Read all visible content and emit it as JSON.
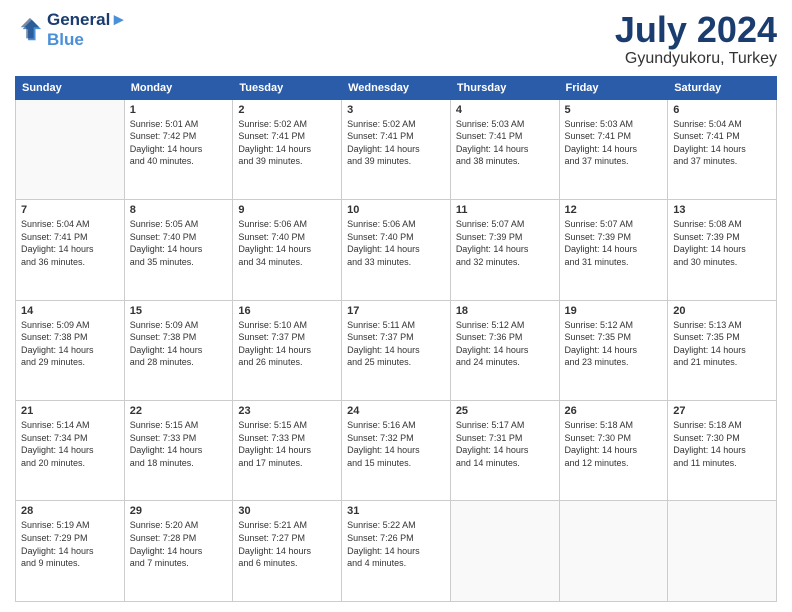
{
  "header": {
    "logo_line1": "General",
    "logo_line2": "Blue",
    "main_title": "July 2024",
    "subtitle": "Gyundyukoru, Turkey"
  },
  "weekdays": [
    "Sunday",
    "Monday",
    "Tuesday",
    "Wednesday",
    "Thursday",
    "Friday",
    "Saturday"
  ],
  "weeks": [
    [
      {
        "day": "",
        "sunrise": "",
        "sunset": "",
        "daylight": ""
      },
      {
        "day": "1",
        "sunrise": "Sunrise: 5:01 AM",
        "sunset": "Sunset: 7:42 PM",
        "daylight": "Daylight: 14 hours and 40 minutes."
      },
      {
        "day": "2",
        "sunrise": "Sunrise: 5:02 AM",
        "sunset": "Sunset: 7:41 PM",
        "daylight": "Daylight: 14 hours and 39 minutes."
      },
      {
        "day": "3",
        "sunrise": "Sunrise: 5:02 AM",
        "sunset": "Sunset: 7:41 PM",
        "daylight": "Daylight: 14 hours and 39 minutes."
      },
      {
        "day": "4",
        "sunrise": "Sunrise: 5:03 AM",
        "sunset": "Sunset: 7:41 PM",
        "daylight": "Daylight: 14 hours and 38 minutes."
      },
      {
        "day": "5",
        "sunrise": "Sunrise: 5:03 AM",
        "sunset": "Sunset: 7:41 PM",
        "daylight": "Daylight: 14 hours and 37 minutes."
      },
      {
        "day": "6",
        "sunrise": "Sunrise: 5:04 AM",
        "sunset": "Sunset: 7:41 PM",
        "daylight": "Daylight: 14 hours and 37 minutes."
      }
    ],
    [
      {
        "day": "7",
        "sunrise": "Sunrise: 5:04 AM",
        "sunset": "Sunset: 7:41 PM",
        "daylight": "Daylight: 14 hours and 36 minutes."
      },
      {
        "day": "8",
        "sunrise": "Sunrise: 5:05 AM",
        "sunset": "Sunset: 7:40 PM",
        "daylight": "Daylight: 14 hours and 35 minutes."
      },
      {
        "day": "9",
        "sunrise": "Sunrise: 5:06 AM",
        "sunset": "Sunset: 7:40 PM",
        "daylight": "Daylight: 14 hours and 34 minutes."
      },
      {
        "day": "10",
        "sunrise": "Sunrise: 5:06 AM",
        "sunset": "Sunset: 7:40 PM",
        "daylight": "Daylight: 14 hours and 33 minutes."
      },
      {
        "day": "11",
        "sunrise": "Sunrise: 5:07 AM",
        "sunset": "Sunset: 7:39 PM",
        "daylight": "Daylight: 14 hours and 32 minutes."
      },
      {
        "day": "12",
        "sunrise": "Sunrise: 5:07 AM",
        "sunset": "Sunset: 7:39 PM",
        "daylight": "Daylight: 14 hours and 31 minutes."
      },
      {
        "day": "13",
        "sunrise": "Sunrise: 5:08 AM",
        "sunset": "Sunset: 7:39 PM",
        "daylight": "Daylight: 14 hours and 30 minutes."
      }
    ],
    [
      {
        "day": "14",
        "sunrise": "Sunrise: 5:09 AM",
        "sunset": "Sunset: 7:38 PM",
        "daylight": "Daylight: 14 hours and 29 minutes."
      },
      {
        "day": "15",
        "sunrise": "Sunrise: 5:09 AM",
        "sunset": "Sunset: 7:38 PM",
        "daylight": "Daylight: 14 hours and 28 minutes."
      },
      {
        "day": "16",
        "sunrise": "Sunrise: 5:10 AM",
        "sunset": "Sunset: 7:37 PM",
        "daylight": "Daylight: 14 hours and 26 minutes."
      },
      {
        "day": "17",
        "sunrise": "Sunrise: 5:11 AM",
        "sunset": "Sunset: 7:37 PM",
        "daylight": "Daylight: 14 hours and 25 minutes."
      },
      {
        "day": "18",
        "sunrise": "Sunrise: 5:12 AM",
        "sunset": "Sunset: 7:36 PM",
        "daylight": "Daylight: 14 hours and 24 minutes."
      },
      {
        "day": "19",
        "sunrise": "Sunrise: 5:12 AM",
        "sunset": "Sunset: 7:35 PM",
        "daylight": "Daylight: 14 hours and 23 minutes."
      },
      {
        "day": "20",
        "sunrise": "Sunrise: 5:13 AM",
        "sunset": "Sunset: 7:35 PM",
        "daylight": "Daylight: 14 hours and 21 minutes."
      }
    ],
    [
      {
        "day": "21",
        "sunrise": "Sunrise: 5:14 AM",
        "sunset": "Sunset: 7:34 PM",
        "daylight": "Daylight: 14 hours and 20 minutes."
      },
      {
        "day": "22",
        "sunrise": "Sunrise: 5:15 AM",
        "sunset": "Sunset: 7:33 PM",
        "daylight": "Daylight: 14 hours and 18 minutes."
      },
      {
        "day": "23",
        "sunrise": "Sunrise: 5:15 AM",
        "sunset": "Sunset: 7:33 PM",
        "daylight": "Daylight: 14 hours and 17 minutes."
      },
      {
        "day": "24",
        "sunrise": "Sunrise: 5:16 AM",
        "sunset": "Sunset: 7:32 PM",
        "daylight": "Daylight: 14 hours and 15 minutes."
      },
      {
        "day": "25",
        "sunrise": "Sunrise: 5:17 AM",
        "sunset": "Sunset: 7:31 PM",
        "daylight": "Daylight: 14 hours and 14 minutes."
      },
      {
        "day": "26",
        "sunrise": "Sunrise: 5:18 AM",
        "sunset": "Sunset: 7:30 PM",
        "daylight": "Daylight: 14 hours and 12 minutes."
      },
      {
        "day": "27",
        "sunrise": "Sunrise: 5:18 AM",
        "sunset": "Sunset: 7:30 PM",
        "daylight": "Daylight: 14 hours and 11 minutes."
      }
    ],
    [
      {
        "day": "28",
        "sunrise": "Sunrise: 5:19 AM",
        "sunset": "Sunset: 7:29 PM",
        "daylight": "Daylight: 14 hours and 9 minutes."
      },
      {
        "day": "29",
        "sunrise": "Sunrise: 5:20 AM",
        "sunset": "Sunset: 7:28 PM",
        "daylight": "Daylight: 14 hours and 7 minutes."
      },
      {
        "day": "30",
        "sunrise": "Sunrise: 5:21 AM",
        "sunset": "Sunset: 7:27 PM",
        "daylight": "Daylight: 14 hours and 6 minutes."
      },
      {
        "day": "31",
        "sunrise": "Sunrise: 5:22 AM",
        "sunset": "Sunset: 7:26 PM",
        "daylight": "Daylight: 14 hours and 4 minutes."
      },
      {
        "day": "",
        "sunrise": "",
        "sunset": "",
        "daylight": ""
      },
      {
        "day": "",
        "sunrise": "",
        "sunset": "",
        "daylight": ""
      },
      {
        "day": "",
        "sunrise": "",
        "sunset": "",
        "daylight": ""
      }
    ]
  ]
}
